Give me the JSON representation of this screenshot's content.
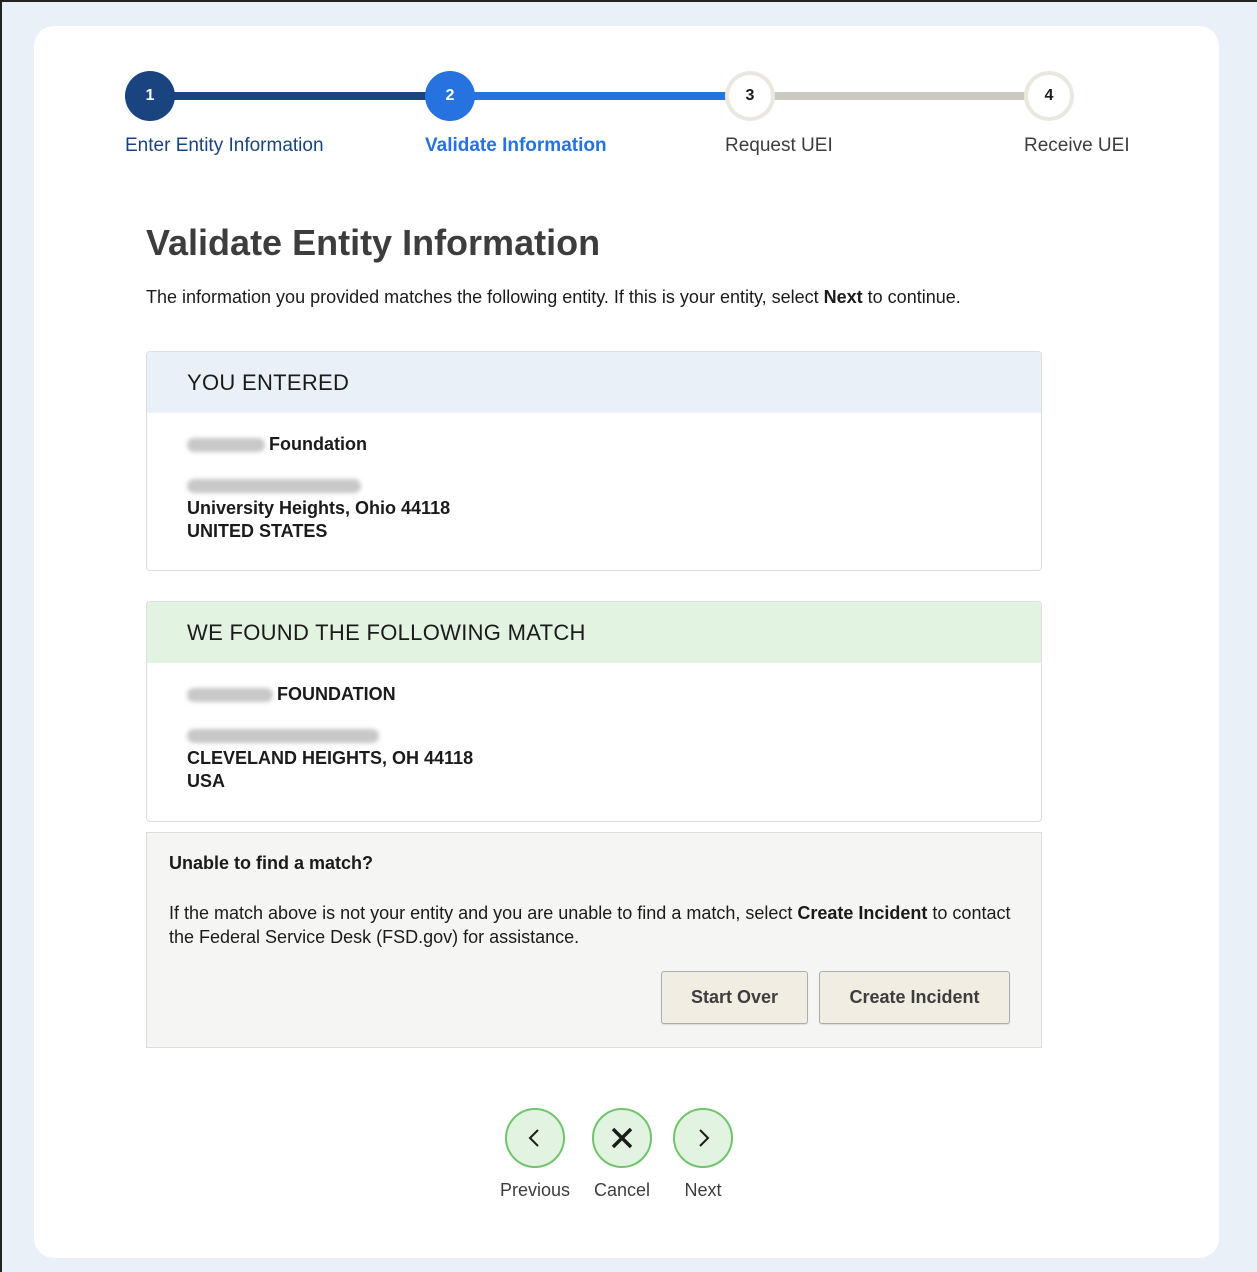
{
  "stepper": {
    "steps": [
      {
        "number": "1",
        "label": "Enter Entity Information",
        "state": "done"
      },
      {
        "number": "2",
        "label": "Validate Information",
        "state": "current"
      },
      {
        "number": "3",
        "label": "Request UEI",
        "state": "todo"
      },
      {
        "number": "4",
        "label": "Receive UEI",
        "state": "todo"
      }
    ]
  },
  "page": {
    "title": "Validate Entity Information",
    "intro_before": "The information you provided matches the following entity. If this is your entity, select ",
    "intro_bold": "Next",
    "intro_after": " to continue."
  },
  "entered": {
    "heading": "YOU ENTERED",
    "name_suffix": "Foundation",
    "city_line": "University Heights, Ohio 44118",
    "country": "UNITED STATES"
  },
  "match": {
    "heading": "WE FOUND THE FOLLOWING MATCH",
    "name_suffix": "FOUNDATION",
    "city_line": "CLEVELAND HEIGHTS, OH 44118",
    "country": "USA"
  },
  "incident": {
    "heading": "Unable to find a match?",
    "text_before": "If the match above is not your entity and you are unable to find a match, select ",
    "text_bold": "Create Incident",
    "text_after": " to contact the Federal Service Desk (FSD.gov) for assistance.",
    "start_over_label": "Start Over",
    "create_incident_label": "Create Incident"
  },
  "nav": {
    "previous_label": "Previous",
    "cancel_label": "Cancel",
    "next_label": "Next",
    "previous_icon": "chevron-left-icon",
    "cancel_icon": "close-icon",
    "next_icon": "chevron-right-icon"
  },
  "colors": {
    "step_done": "#1a4480",
    "step_current": "#2672de",
    "step_todo": "#ebe8df",
    "match_header": "#e3f3e1",
    "entered_header": "#eaf0f7"
  }
}
